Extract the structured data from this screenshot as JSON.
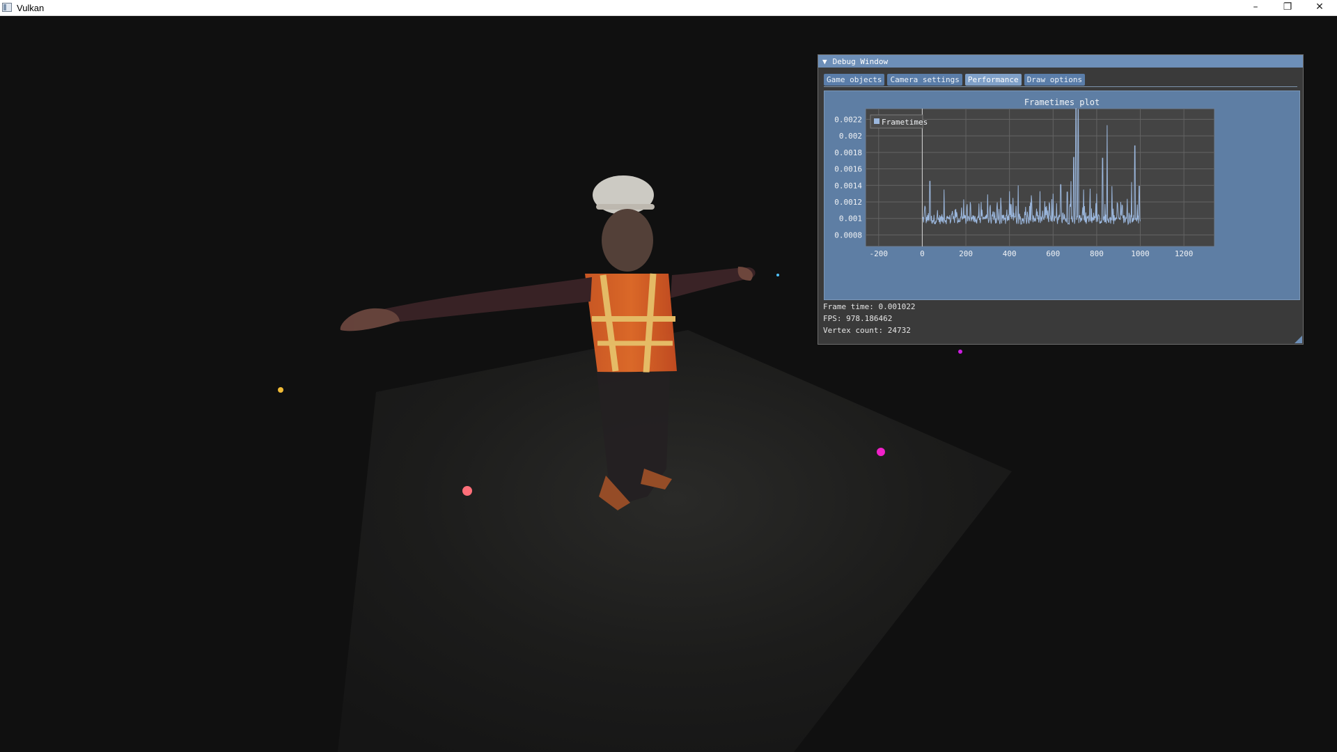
{
  "window": {
    "title": "Vulkan",
    "controls": {
      "minimize": "–",
      "maximize": "❐",
      "close": "✕"
    }
  },
  "debug": {
    "title": "Debug Window",
    "collapse_icon": "▼",
    "tabs": [
      {
        "label": "Game objects",
        "active": false
      },
      {
        "label": "Camera settings",
        "active": false
      },
      {
        "label": "Performance",
        "active": true
      },
      {
        "label": "Draw options",
        "active": false
      }
    ],
    "stats": {
      "frame_time": "Frame time: 0.001022",
      "fps": "FPS: 978.186462",
      "vertex_count": "Vertex count: 24732"
    }
  },
  "chart_data": {
    "type": "line",
    "title": "Frametimes plot",
    "xlabel": "",
    "ylabel": "",
    "xlim": [
      -260,
      1340
    ],
    "ylim": [
      0.00066,
      0.00233
    ],
    "x_ticks": [
      -200,
      0,
      200,
      400,
      600,
      800,
      1000,
      1200
    ],
    "x_tick_labels": [
      "-200",
      "0",
      "200",
      "400",
      "600",
      "800",
      "1000",
      "1200"
    ],
    "y_ticks": [
      0.0008,
      0.001,
      0.0012,
      0.0014,
      0.0016,
      0.0018,
      0.002,
      0.0022
    ],
    "y_tick_labels": [
      "0.0008",
      "0.001",
      "0.0012",
      "0.0014",
      "0.0016",
      "0.0018",
      "0.002",
      "0.0022"
    ],
    "grid": true,
    "legend": {
      "position": "top-left",
      "label": "Frametimes"
    },
    "series": [
      {
        "name": "Frametimes",
        "color": "#9bb7dd",
        "x_start": 0,
        "x_end": 1000,
        "baseline": 0.00093,
        "peaks": [
          [
            10,
            0.0011
          ],
          [
            35,
            0.00145
          ],
          [
            70,
            0.0011
          ],
          [
            100,
            0.00135
          ],
          [
            135,
            0.00105
          ],
          [
            190,
            0.00123
          ],
          [
            260,
            0.00118
          ],
          [
            300,
            0.00129
          ],
          [
            325,
            0.00108
          ],
          [
            360,
            0.00125
          ],
          [
            400,
            0.00133
          ],
          [
            440,
            0.0014
          ],
          [
            470,
            0.00108
          ],
          [
            500,
            0.00128
          ],
          [
            540,
            0.00133
          ],
          [
            570,
            0.00115
          ],
          [
            600,
            0.0013
          ],
          [
            635,
            0.00141
          ],
          [
            665,
            0.00132
          ],
          [
            682,
            0.00145
          ],
          [
            695,
            0.00174
          ],
          [
            705,
            0.00233
          ],
          [
            715,
            0.00232
          ],
          [
            740,
            0.00135
          ],
          [
            770,
            0.00136
          ],
          [
            800,
            0.0013
          ],
          [
            827,
            0.00173
          ],
          [
            848,
            0.00213
          ],
          [
            870,
            0.00139
          ],
          [
            910,
            0.0012
          ],
          [
            960,
            0.00144
          ],
          [
            975,
            0.00188
          ],
          [
            995,
            0.00139
          ]
        ]
      }
    ]
  }
}
